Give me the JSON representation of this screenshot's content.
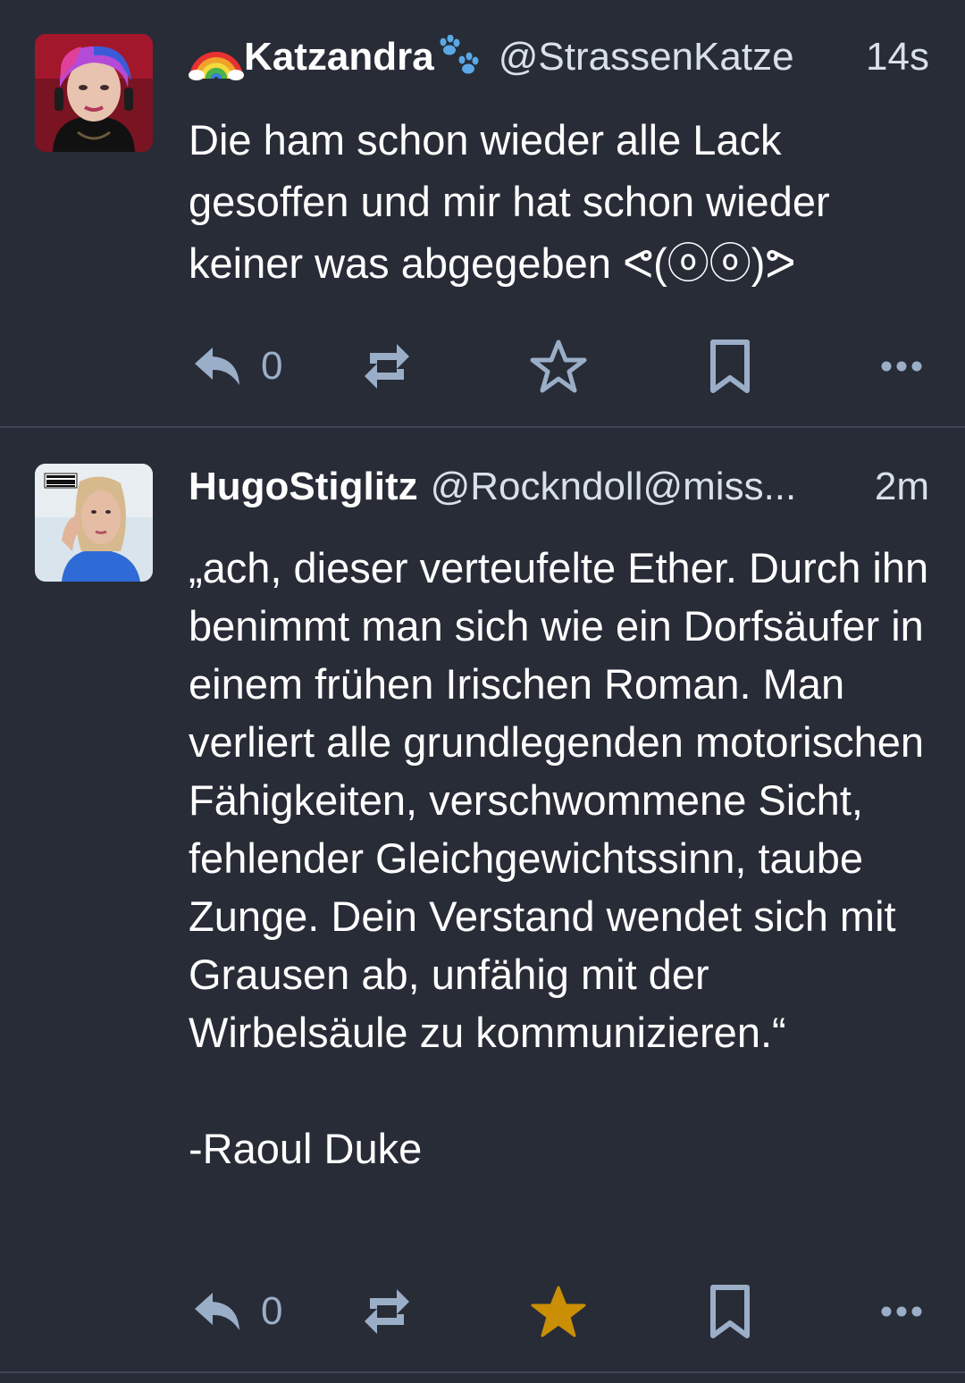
{
  "posts": [
    {
      "display_name": "Katzandra",
      "name_prefix_icon": "rainbow-icon",
      "name_suffix_icon": "paw-prints-icon",
      "handle": "@StrassenKatze",
      "time": "14s",
      "content": "Die ham schon wieder alle Lack gesoffen und mir hat schon wieder keiner was abgegeben ᕙ(ⓞⓞ)ᕗ",
      "reply_count": "0",
      "favourited": false,
      "icons": [
        "reply-icon",
        "boost-icon",
        "star-icon",
        "bookmark-icon",
        "more-icon"
      ]
    },
    {
      "display_name": "HugoStiglitz",
      "handle": "@Rockndoll@miss...",
      "time": "2m",
      "content": "„ach, dieser verteufelte Ether. Durch ihn benimmt man sich wie ein Dorfsäufer in einem frühen Irischen Roman. Man verliert alle grundlegenden motorischen Fähigkeiten, verschwommene Sicht, fehlender Gleichgewichtssinn, taube Zunge. Dein Verstand wendet sich mit Grausen ab, unfähig mit der Wirbelsäule zu kommunizieren.“\n\n-Raoul Duke",
      "reply_count": "0",
      "favourited": true,
      "icons": [
        "reply-icon",
        "boost-icon",
        "star-icon",
        "bookmark-icon",
        "more-icon"
      ]
    }
  ],
  "colors": {
    "background": "#282c37",
    "divider": "#3f4556",
    "icon": "#9baec8",
    "favourite": "#ca8f04",
    "text": "#ffffff",
    "handle": "#d9e1e8"
  }
}
